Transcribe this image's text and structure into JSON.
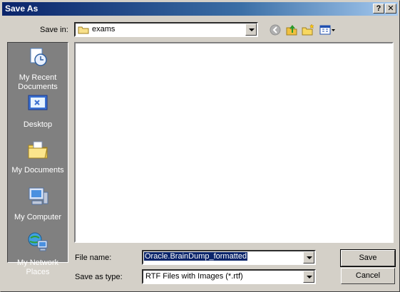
{
  "window": {
    "title": "Save As"
  },
  "title_buttons": {
    "help": "?",
    "close": "✕"
  },
  "savein": {
    "label": "Save in:",
    "value": "exams"
  },
  "toolbar": {
    "back_icon": "back-arrow-icon",
    "up_icon": "up-folder-icon",
    "newfolder_icon": "new-folder-icon",
    "views_icon": "views-menu-icon"
  },
  "places": [
    {
      "label": "My Recent Documents",
      "icon": "recent-documents-icon"
    },
    {
      "label": "Desktop",
      "icon": "desktop-icon"
    },
    {
      "label": "My Documents",
      "icon": "my-documents-icon"
    },
    {
      "label": "My Computer",
      "icon": "my-computer-icon"
    },
    {
      "label": "My Network Places",
      "icon": "network-places-icon"
    }
  ],
  "filename": {
    "label": "File name:",
    "value": "Oracle.BrainDump_formatted"
  },
  "savetype": {
    "label": "Save as type:",
    "value": "RTF Files with Images (*.rtf)"
  },
  "buttons": {
    "save": "Save",
    "cancel": "Cancel"
  }
}
